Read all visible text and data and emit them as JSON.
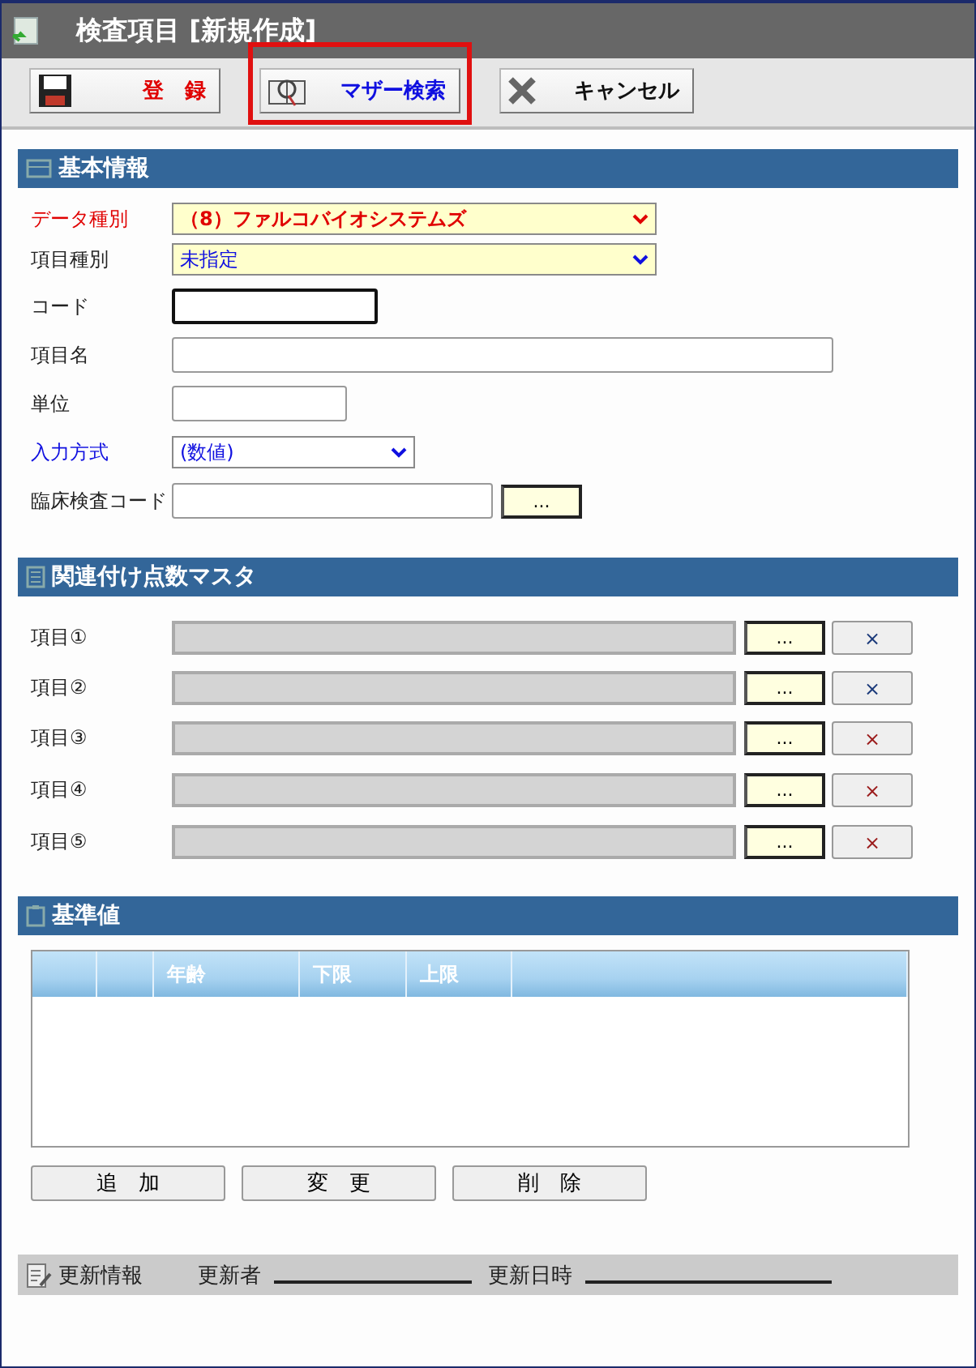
{
  "window": {
    "title": "検査項目 [新規作成]"
  },
  "toolbar": [
    {
      "kind": "save",
      "label": "登　録",
      "highlighted": false
    },
    {
      "kind": "search",
      "label": "マザー検索",
      "highlighted": true
    },
    {
      "kind": "cancel",
      "label": "キャンセル",
      "highlighted": false
    }
  ],
  "basic_info": {
    "title": "基本情報",
    "fields": [
      {
        "kind": "select",
        "label": "データ種別",
        "required": true,
        "value": "（8）ファルコバイオシステムズ",
        "highlight": true
      },
      {
        "kind": "select",
        "label": "項目種別",
        "required": false,
        "value": "未指定",
        "highlight": true
      },
      {
        "kind": "input",
        "label": "コード",
        "required": false,
        "focused": true
      },
      {
        "kind": "input",
        "label": "項目名",
        "required": false,
        "focused": false
      },
      {
        "kind": "input",
        "label": "単位",
        "required": false,
        "focused": false
      },
      {
        "kind": "select",
        "label": "入力方式",
        "required": false,
        "value": "(数値)",
        "highlight": false,
        "accent": true
      },
      {
        "kind": "lookup",
        "label": "臨床検査コード",
        "required": false,
        "button": "..."
      }
    ]
  },
  "linked_master": {
    "title": "関連付け点数マスタ",
    "items": [
      {
        "label": "項目①",
        "button": "...",
        "clear": "×"
      },
      {
        "label": "項目②",
        "button": "...",
        "clear": "×"
      },
      {
        "label": "項目③",
        "button": "...",
        "clear": "×"
      },
      {
        "label": "項目④",
        "button": "...",
        "clear": "×"
      },
      {
        "label": "項目⑤",
        "button": "...",
        "clear": "×"
      }
    ]
  },
  "reference": {
    "title": "基準値",
    "table": {
      "columns": [
        "",
        "",
        "年齢",
        "下限",
        "上限",
        ""
      ]
    },
    "buttons": [
      "追　加",
      "変　更",
      "削　除"
    ]
  },
  "update_info": {
    "title": "更新情報",
    "updated_by": "更新者",
    "updated_at": "更新日時"
  }
}
